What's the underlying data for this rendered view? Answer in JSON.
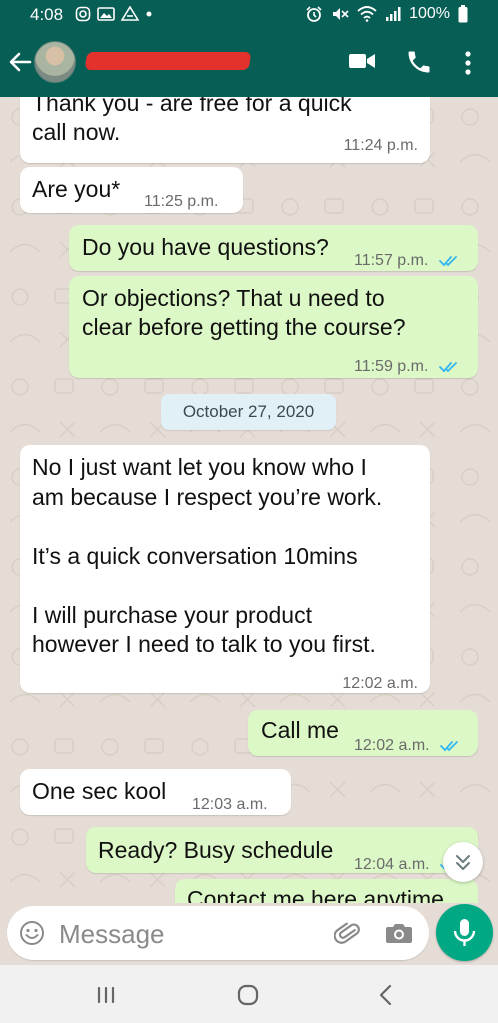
{
  "status_bar": {
    "time": "4:08",
    "battery": "100%"
  },
  "contact": {
    "name": ""
  },
  "messages": [
    {
      "dir": "in",
      "text": "Thank you - are free for a quick\ncall now.",
      "time": "11:24 p.m."
    },
    {
      "dir": "in",
      "text": "Are you*",
      "time": "11:25 p.m."
    },
    {
      "dir": "out",
      "text": "Do you have questions?",
      "time": "11:57 p.m.",
      "read": true
    },
    {
      "dir": "out",
      "text": "Or objections? That u need to\nclear before getting the course?",
      "time": "11:59 p.m.",
      "read": true
    },
    {
      "dir": "in",
      "text": "No I just want let you know who I\nam because I respect you’re work.\n\nIt’s a quick conversation 10mins\n\nI will purchase your product\nhowever I need to talk to you first.",
      "time": "12:02 a.m."
    },
    {
      "dir": "out",
      "text": "Call me",
      "time": "12:02 a.m.",
      "read": true
    },
    {
      "dir": "in",
      "text": "One sec kool",
      "time": "12:03 a.m."
    },
    {
      "dir": "out",
      "text": "Ready? Busy schedule",
      "time": "12:04 a.m.",
      "read": true
    },
    {
      "dir": "out",
      "text": "Contact me here anytime",
      "time": ""
    }
  ],
  "date_separator": "October 27, 2020",
  "composer": {
    "placeholder": "Message"
  },
  "icons": {
    "back": "arrow-left-icon",
    "video": "video-call-icon",
    "call": "phone-icon",
    "menu": "more-vert-icon",
    "emoji": "emoji-icon",
    "attach": "paperclip-icon",
    "camera": "camera-icon",
    "mic": "mic-icon",
    "scroll": "double-chevron-down-icon"
  },
  "colors": {
    "header": "#075e54",
    "outgoing": "#dcf8c6",
    "incoming": "#ffffff",
    "tick": "#34b7f1",
    "mic": "#00a884"
  }
}
